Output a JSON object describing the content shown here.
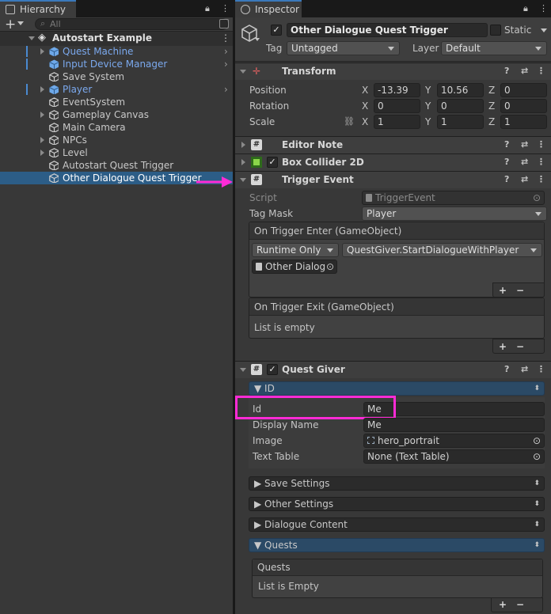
{
  "hierarchy": {
    "tab_label": "Hierarchy",
    "search_placeholder": "All",
    "add_label": "+",
    "root": "Autostart Example",
    "items": [
      {
        "label": "Quest Machine",
        "prefab": true,
        "expandable": true
      },
      {
        "label": "Input Device Manager",
        "prefab": true,
        "expandable": false
      },
      {
        "label": "Save System",
        "prefab": false,
        "expandable": false
      },
      {
        "label": "Player",
        "prefab": true,
        "expandable": true
      },
      {
        "label": "EventSystem",
        "prefab": false,
        "expandable": false
      },
      {
        "label": "Gameplay Canvas",
        "prefab": false,
        "expandable": true
      },
      {
        "label": "Main Camera",
        "prefab": false,
        "expandable": false
      },
      {
        "label": "NPCs",
        "prefab": false,
        "expandable": true
      },
      {
        "label": "Level",
        "prefab": false,
        "expandable": true
      },
      {
        "label": "Autostart Quest Trigger",
        "prefab": false,
        "expandable": false
      },
      {
        "label": "Other Dialogue Quest Trigger",
        "prefab": false,
        "expandable": false,
        "selected": true
      }
    ]
  },
  "inspector": {
    "tab_label": "Inspector",
    "object_name": "Other Dialogue Quest Trigger",
    "static_label": "Static",
    "tag_label": "Tag",
    "tag_value": "Untagged",
    "layer_label": "Layer",
    "layer_value": "Default",
    "transform": {
      "title": "Transform",
      "position_label": "Position",
      "rotation_label": "Rotation",
      "scale_label": "Scale",
      "x": "X",
      "y": "Y",
      "z": "Z",
      "position": [
        "-13.39",
        "10.56",
        "0"
      ],
      "rotation": [
        "0",
        "0",
        "0"
      ],
      "scale": [
        "1",
        "1",
        "1"
      ]
    },
    "editor_note": {
      "title": "Editor Note"
    },
    "box_collider": {
      "title": "Box Collider 2D"
    },
    "trigger_event": {
      "title": "Trigger Event",
      "script_label": "Script",
      "script_value": "TriggerEvent",
      "tagmask_label": "Tag Mask",
      "tagmask_value": "Player",
      "enter_title": "On Trigger Enter (GameObject)",
      "runtime": "Runtime Only",
      "function": "QuestGiver.StartDialogueWithPlayer",
      "object_ref": "Other Dialogu",
      "exit_title": "On Trigger Exit (GameObject)",
      "exit_empty": "List is empty",
      "plus": "+",
      "minus": "−"
    },
    "quest_giver": {
      "title": "Quest Giver",
      "id_section": "ID",
      "id_label": "Id",
      "id_value": "Me",
      "display_label": "Display Name",
      "display_value": "Me",
      "image_label": "Image",
      "image_value": "hero_portrait",
      "texttable_label": "Text Table",
      "texttable_value": "None (Text Table)",
      "save_settings": "Save Settings",
      "other_settings": "Other Settings",
      "dialogue_content": "Dialogue Content",
      "quests_section": "Quests",
      "quests_header": "Quests",
      "quests_empty": "List is Empty"
    }
  },
  "colors": {
    "highlight": "#ff2bd6",
    "selection": "#2c5d87",
    "prefab_text": "#7ba9ee"
  }
}
